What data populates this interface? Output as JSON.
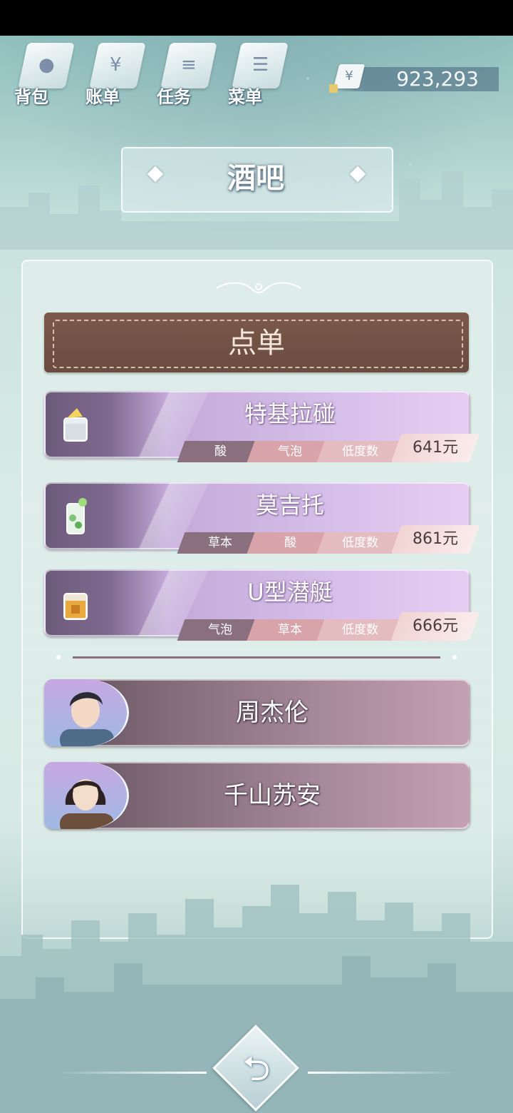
{
  "nav": {
    "items": [
      {
        "label": "背包",
        "icon": "backpack-icon"
      },
      {
        "label": "账单",
        "icon": "bill-icon"
      },
      {
        "label": "任务",
        "icon": "task-icon"
      },
      {
        "label": "菜单",
        "icon": "menu-icon"
      }
    ]
  },
  "currency": {
    "symbol": "¥",
    "amount": "923,293"
  },
  "location": {
    "title": "酒吧"
  },
  "order": {
    "title": "点单",
    "drinks": [
      {
        "name": "特基拉碰",
        "tags": [
          "酸",
          "气泡",
          "低度数"
        ],
        "price": "641元"
      },
      {
        "name": "莫吉托",
        "tags": [
          "草本",
          "酸",
          "低度数"
        ],
        "price": "861元"
      },
      {
        "name": "U型潜艇",
        "tags": [
          "气泡",
          "草本",
          "低度数"
        ],
        "price": "666元"
      }
    ]
  },
  "characters": [
    {
      "name": "周杰伦"
    },
    {
      "name": "千山苏安"
    }
  ],
  "back": {
    "glyph": "⮌"
  }
}
